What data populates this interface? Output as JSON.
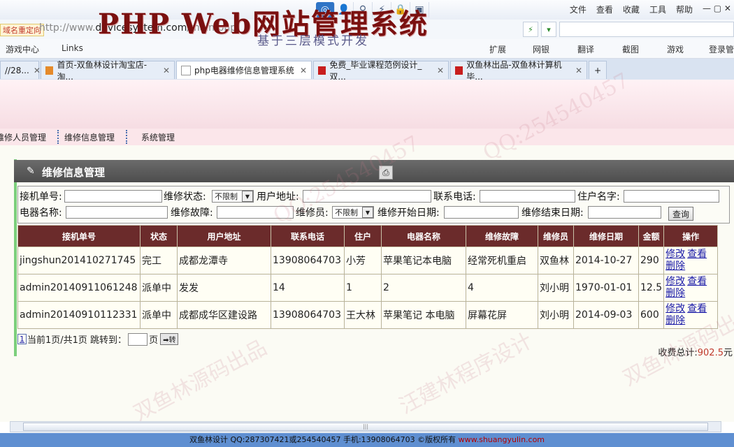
{
  "browser": {
    "menu": [
      "文件",
      "查看",
      "收藏",
      "工具",
      "帮助"
    ],
    "address_label": "域名重定向",
    "url_prefix": "http://www.",
    "url_domain": "devicesystem.com",
    "url_path": "/main.php",
    "favorites": [
      "游戏中心",
      "Links"
    ],
    "fav_right": [
      "扩展",
      "网银",
      "翻译",
      "截图",
      "游戏",
      "登录管"
    ],
    "tabs": [
      {
        "label": "//28...",
        "active": false
      },
      {
        "label": "首页-双鱼林设计淘宝店-淘...",
        "active": false
      },
      {
        "label": "php电器维修信息管理系统",
        "active": true
      },
      {
        "label": "免费_毕业课程范例设计_双...",
        "active": false
      },
      {
        "label": "双鱼林出品-双鱼林计算机毕...",
        "active": false
      }
    ]
  },
  "header": {
    "title": "PHP Web网站管理系统",
    "subtitle": "基于三层模式开发"
  },
  "nav": {
    "items": [
      "维修人员管理",
      "维修信息管理",
      "系统管理"
    ]
  },
  "panel": {
    "title": "维修信息管理"
  },
  "search": {
    "order_no_label": "接机单号:",
    "status_label": "维修状态:",
    "status_value": "不限制",
    "address_label": "用户地址:",
    "phone_label": "联系电话:",
    "resident_label": "住户名字:",
    "device_label": "电器名称:",
    "fault_label": "维修故障:",
    "repairman_label": "维修员:",
    "repairman_value": "不限制",
    "start_label": "维修开始日期:",
    "end_label": "维修结束日期:",
    "query_button": "查询"
  },
  "table": {
    "headers": [
      "接机单号",
      "状态",
      "用户地址",
      "联系电话",
      "住户",
      "电器名称",
      "维修故障",
      "维修员",
      "维修日期",
      "金额",
      "操作"
    ],
    "rows": [
      [
        "jingshun201410271745",
        "完工",
        "成都龙潭寺",
        "13908064703",
        "小芳",
        "苹果笔记本电脑",
        "经常死机重启",
        "双鱼林",
        "2014-10-27",
        "290"
      ],
      [
        "admin20140911061248",
        "派单中",
        "发发",
        "14",
        "1",
        "2",
        "4",
        "刘小明",
        "1970-01-01",
        "12.5"
      ],
      [
        "admin20140910112331",
        "派单中",
        "成都成华区建设路",
        "13908064703",
        "王大林",
        "苹果笔记 本电脑",
        "屏幕花屏",
        "刘小明",
        "2014-09-03",
        "600"
      ]
    ],
    "ops": {
      "edit": "修改",
      "view": "查看",
      "delete": "删除"
    }
  },
  "pager": {
    "page_num": "1",
    "text": "当前1页/共1页 跳转到：",
    "page_unit": "页",
    "go": "➡转"
  },
  "total": {
    "label": "收费总计:",
    "amount": "902.5",
    "unit": "元"
  },
  "footer": {
    "text": "双鱼林设计 QQ:287307421或254540457 手机:13908064703 ©版权所有 ",
    "site": "www.shuangyulin.com"
  },
  "watermarks": [
    "双鱼林源码出品",
    "QQ:254540457",
    "汪建林程序设计"
  ],
  "colors": {
    "table_header": "#6b2b2b",
    "panel_accent": "#7ccf7c",
    "banner_title": "#7a1010",
    "footer_bg": "#5f8fd1"
  }
}
